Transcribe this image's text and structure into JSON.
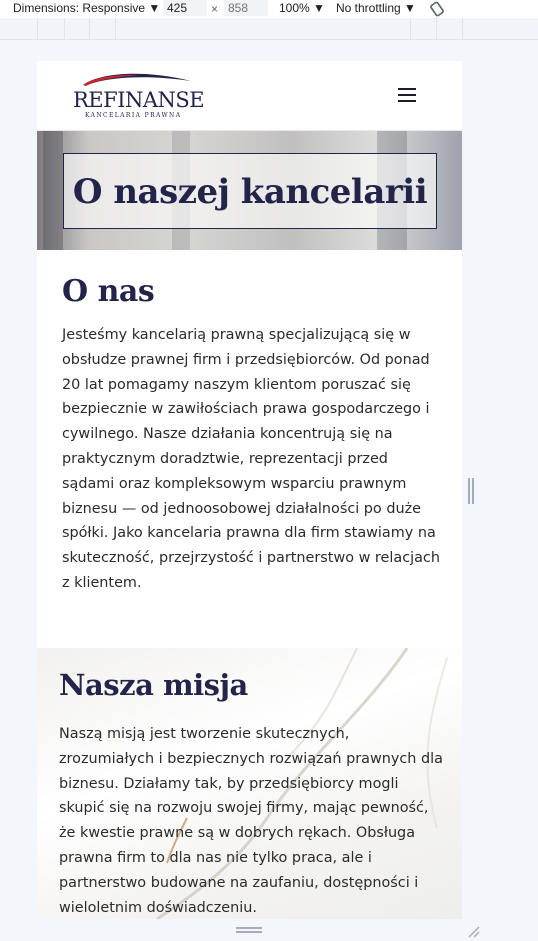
{
  "devtools": {
    "dimensions_label": "Dimensions: Responsive ▼",
    "width_value": "425",
    "times": "×",
    "height_placeholder": "858",
    "zoom_label": "100% ▼",
    "throttling_label": "No throttling ▼",
    "rotate_icon": "rotate-icon"
  },
  "site": {
    "logo": {
      "name": "REFINANSE",
      "tagline": "KANCELARIA PRAWNA",
      "colors": {
        "red": "#c1272d",
        "navy": "#23244a"
      }
    },
    "menu_icon": "hamburger-icon",
    "hero_title": "O naszej kancelarii",
    "about": {
      "heading": "O nas",
      "text": "Jesteśmy kancelarią prawną specjalizującą się w obsłudze prawnej firm i przedsiębiorców. Od ponad 20 lat pomagamy naszym klientom poruszać się bezpiecznie w zawiłościach prawa gospodarczego i cywilnego. Nasze działania koncentrują się na praktycznym doradztwie, reprezentacji przed sądami oraz kompleksowym wsparciu prawnym biznesu — od jednoosobowej działalności po duże spółki. Jako kancelaria prawna dla firm stawiamy na skuteczność, przejrzystość i partnerstwo w relacjach z klientem."
    },
    "mission": {
      "heading": "Nasza misja",
      "text": "Naszą misją jest tworzenie skutecznych, zrozumiałych i bezpiecznych rozwiązań prawnych dla biznesu. Działamy tak, by przedsiębiorcy mogli skupić się na rozwoju swojej firmy, mając pewność, że kwestie prawne są w dobrych rękach. Obsługa prawna firm to dla nas nie tylko praca, ale i partnerstwo budowane na zaufaniu, dostępności i wieloletnim doświadczeniu."
    }
  }
}
